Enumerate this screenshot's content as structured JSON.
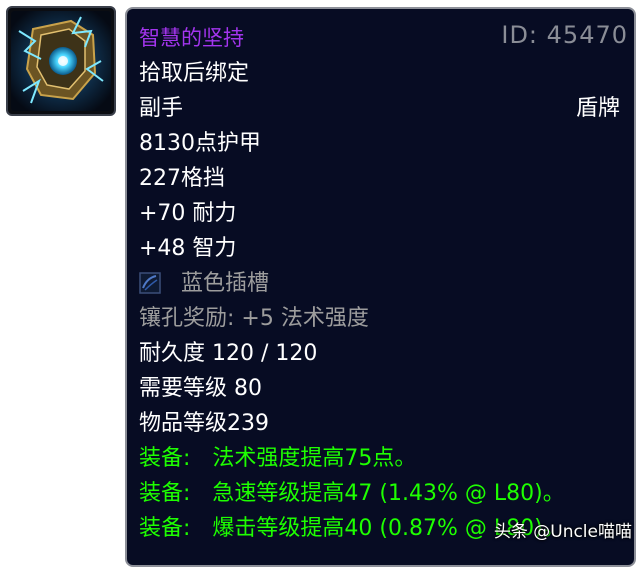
{
  "item": {
    "name": "智慧的坚持",
    "id_label": "ID: 45470",
    "bind": "拾取后绑定",
    "slot": "副手",
    "type": "盾牌",
    "armor": "8130点护甲",
    "block": "227格挡",
    "stamina": "+70 耐力",
    "intellect": "+48 智力",
    "socket": "蓝色插槽",
    "socket_bonus": "镶孔奖励: +5 法术强度",
    "durability": "耐久度 120 / 120",
    "required_level": "需要等级 80",
    "item_level": "物品等级239",
    "equip_effects": [
      {
        "label": "装备:",
        "text": "法术强度提高75点。"
      },
      {
        "label": "装备:",
        "text": "急速等级提高47 (1.43% @ L80)。"
      },
      {
        "label": "装备:",
        "text": "爆击等级提高40 (0.87% @ L80)。"
      }
    ]
  },
  "watermark": "头条 @Uncle喵喵",
  "colors": {
    "epic_purple": "#a335ee",
    "equip_green": "#1eff00",
    "socket_gray": "#9d9d9d",
    "tooltip_bg": "#070c23"
  },
  "icons": [
    "item-shield-icon",
    "blue-socket-icon"
  ]
}
